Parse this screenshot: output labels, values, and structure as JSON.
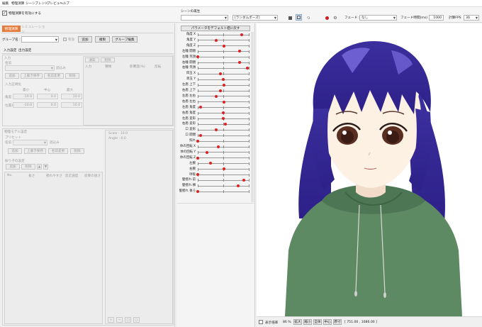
{
  "menubar": {
    "items": [
      "編集",
      "物理演算",
      "シーンブレンド",
      "プレビュー",
      "ヘルプ"
    ]
  },
  "toolbar": {
    "physics_toggle_label": "物理演算を有効にする",
    "scene_label": "シーンの再生",
    "scene_select": "",
    "pose_select": "[ランダムポーズ]",
    "fade_label": "フェード :",
    "fade_value": "なし",
    "fade_time_label": "フェード時間(ms) :",
    "fade_time_value": "1000",
    "fps_label": "計算FPS",
    "fps_value": "30"
  },
  "physics_panel": {
    "tabs": [
      "物理演算",
      "シミュレーション"
    ],
    "group_name_label": "グループ名 :",
    "group_name_value": "",
    "enabled_label": "有効",
    "add_label": "追加",
    "duplicate_label": "複製",
    "group_edit_label": "グループ編集",
    "subtabs": [
      "入力設定",
      "出力設定"
    ],
    "input": {
      "section": "入力",
      "name_label": "名前",
      "load_label": "読込み",
      "buttons": [
        "追加",
        "上書き保存",
        "名前変更",
        "削除"
      ],
      "table_headers": [
        "通知",
        "削除"
      ],
      "columns": [
        "入力",
        "種類",
        "影響度(%)",
        "反転"
      ],
      "range_label": "入力正規化",
      "range_cols": [
        "最小",
        "中心",
        "最大"
      ],
      "angle_label": "角度",
      "angle_values": [
        "-10.0",
        "0.0",
        "10.0"
      ],
      "position_label": "位置X",
      "position_values": [
        "-10.0",
        "0.0",
        "10.0"
      ]
    },
    "physics_settings": {
      "section": "物理モデル設定",
      "preset_section": "プリセット",
      "name_label": "名前",
      "load_label": "読込み",
      "buttons": [
        "追加",
        "上書き保存",
        "名前変更",
        "削除"
      ],
      "pendulum_section": "振り子の設定",
      "add_label": "追加",
      "delete_label": "削除",
      "table_cols": [
        "No.",
        "長さ",
        "揺れやすさ",
        "反応速度",
        "収束の速さ"
      ],
      "readout_scale": "Scale : 10.0",
      "readout_angle": "Angle : 0.0"
    }
  },
  "params_panel": {
    "reset_label": "パラメータをデフォルト値に戻す",
    "rows": [
      {
        "name": "角度 X",
        "value": 0.86
      },
      {
        "name": "角度 Y",
        "value": 0.36
      },
      {
        "name": "角度 Z",
        "value": 0.52
      },
      {
        "name": "左瞳 開閉",
        "value": 0.82
      },
      {
        "name": "左瞳 笑顔",
        "value": 0.0
      },
      {
        "name": "右瞳 開閉",
        "value": 0.82
      },
      {
        "name": "右瞳 笑顔",
        "value": 0.97
      },
      {
        "name": "目玉 X",
        "value": 0.45
      },
      {
        "name": "目玉 Y",
        "value": 0.5
      },
      {
        "name": "左眉 上下",
        "value": 0.52
      },
      {
        "name": "右眉 上下",
        "value": 0.45
      },
      {
        "name": "左眉 左右",
        "value": 0.36
      },
      {
        "name": "右眉 左右",
        "value": 0.52
      },
      {
        "name": "左眉 角度",
        "value": 0.05
      },
      {
        "name": "右眉 角度",
        "value": 0.5
      },
      {
        "name": "左眉 変形",
        "value": 0.5
      },
      {
        "name": "右眉 変形",
        "value": 0.54
      },
      {
        "name": "口 変形",
        "value": 0.36
      },
      {
        "name": "口 開閉",
        "value": 0.05
      },
      {
        "name": "照れ",
        "value": 0.0
      },
      {
        "name": "体の回転 X",
        "value": 0.4
      },
      {
        "name": "体の回転 Y",
        "value": 0.18
      },
      {
        "name": "体の回転 Z",
        "value": 0.0
      },
      {
        "name": "左腕",
        "value": 0.25
      },
      {
        "name": "右腕",
        "value": 0.52
      },
      {
        "name": "呼吸",
        "value": 0.0
      },
      {
        "name": "髪揺れ 前",
        "value": 0.9
      },
      {
        "name": "髪揺れ 横",
        "value": 0.79
      },
      {
        "name": "髪揺れ 後ろ",
        "value": 0.0
      }
    ]
  },
  "statusbar": {
    "display_label": "表示倍率",
    "zoom": "86 %",
    "buttons": [
      "拡大",
      "縮小",
      "全体",
      "中心",
      "原寸"
    ],
    "coords": "[ 751.00 , 1086.00 ]"
  },
  "colors": {
    "hair": "#3c2f9e",
    "hoodie": "#5e8a63",
    "skin": "#fdf1e4",
    "eye": "#5a2f22",
    "accent_tab": "#e57b3a"
  }
}
